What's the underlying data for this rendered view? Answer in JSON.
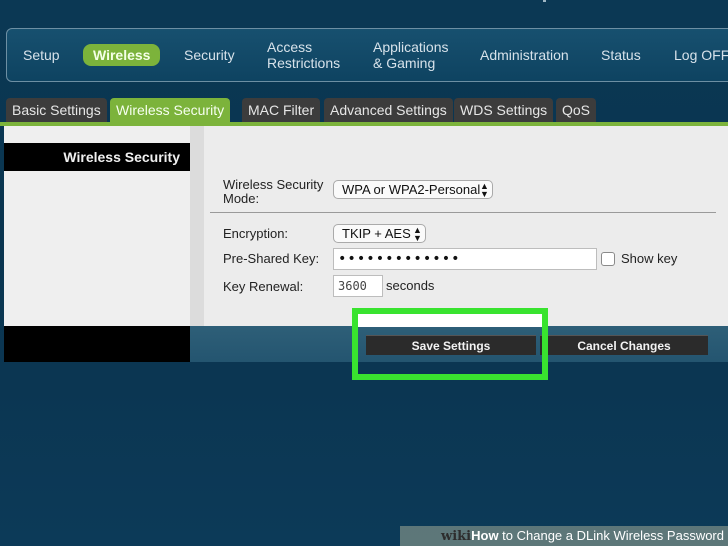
{
  "main_nav": [
    {
      "label": "Setup",
      "active": false
    },
    {
      "label": "Wireless",
      "active": true
    },
    {
      "label": "Security",
      "active": false
    },
    {
      "label": "Access\nRestrictions",
      "active": false
    },
    {
      "label": "Applications\n& Gaming",
      "active": false
    },
    {
      "label": "Administration",
      "active": false
    },
    {
      "label": "Status",
      "active": false
    },
    {
      "label": "Log OFF",
      "active": false
    }
  ],
  "sub_tabs": [
    {
      "label": "Basic Settings",
      "active": false
    },
    {
      "label": "Wireless Security",
      "active": true
    },
    {
      "label": "MAC Filter",
      "active": false
    },
    {
      "label": "Advanced Settings",
      "active": false
    },
    {
      "label": "WDS Settings",
      "active": false
    },
    {
      "label": "QoS",
      "active": false
    }
  ],
  "section_title": "Wireless Security",
  "form": {
    "mode_label": "Wireless Security\nMode:",
    "mode_value": "WPA or WPA2-Personal",
    "encryption_label": "Encryption:",
    "encryption_value": "TKIP + AES",
    "psk_label": "Pre-Shared Key:",
    "psk_value": "•••••••••••••",
    "show_key_label": "Show key",
    "show_key_checked": false,
    "renewal_label": "Key Renewal:",
    "renewal_value": "3600",
    "renewal_unit": "seconds"
  },
  "actions": {
    "save_label": "Save Settings",
    "cancel_label": "Cancel Changes"
  },
  "footer": {
    "wiki": "wiki",
    "how": "How",
    "rest": " to Change a DLink Wireless Password"
  },
  "colors": {
    "accent": "#7cb33b",
    "highlight": "#39e32f",
    "background": "#0b3854"
  }
}
